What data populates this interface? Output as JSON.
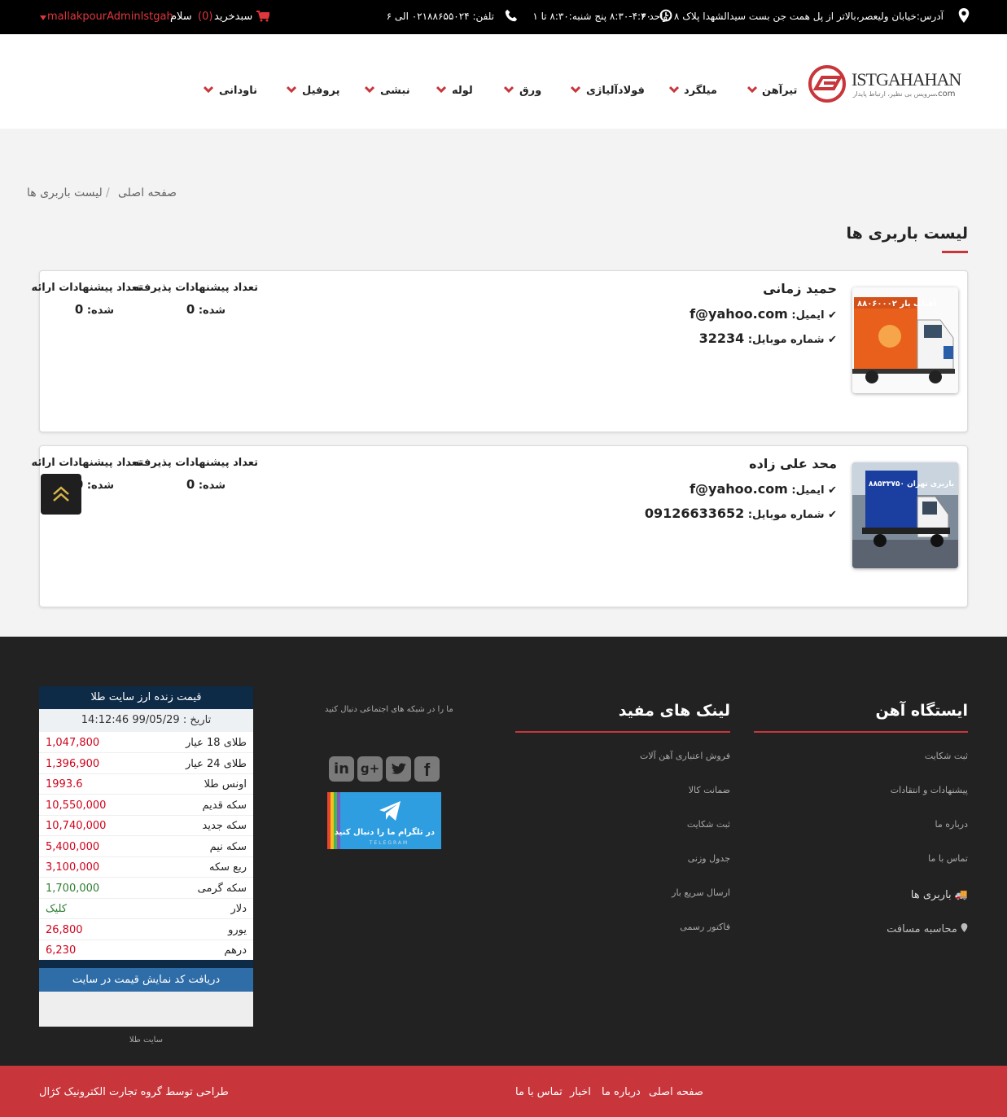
{
  "topbar": {
    "address": "آدرس:خیابان ولیعصر،بالاتر از پل همت جن بست سیدالشهدا پلاک ۸ ،واحد ۶",
    "hours": "۸:۳۰-۴:۳۰ پنج شنبه:۸:۳۰ تا ۱",
    "phone": "تلفن: ۰۲۱۸۸۶۵۵۰۲۴ الی ۶",
    "cart_label": "سبدخرید",
    "cart_count": "(0)",
    "greeting": "سلام",
    "username": "mallakpourAdminIstgah"
  },
  "brand": {
    "name": "ISTGAHAHAN",
    "suffix": ".com",
    "tagline": "سرویس بی نظیر، ارتباط پایدار"
  },
  "nav": [
    "تیرآهن",
    "میلگرد",
    "فولادآلیاژی",
    "ورق",
    "لوله",
    "نبشی",
    "پروفیل",
    "ناودانی"
  ],
  "breadcrumb": {
    "home": "صفحه اصلی",
    "sep": "/",
    "current": "لیست باربری ها"
  },
  "page_title": "لیست باربری ها",
  "carriers": [
    {
      "name": "حمید زمانی",
      "email_label": "ایمیل:",
      "email": "f@yahoo.com",
      "mobile_label": "شماره موبایل:",
      "mobile": "32234",
      "accepted_label": "تعداد پیشنهادات پذیرفته",
      "accepted_suffix": "شده:",
      "accepted": "0",
      "offered_label": "تعداد پیشنهادات ارائه",
      "offered_suffix": "شده:",
      "offered": "0",
      "truck_text": "آفتاب بار ۸۸۰۶۰۰۰۲"
    },
    {
      "name": "محد علی زاده",
      "email_label": "ایمیل:",
      "email": "f@yahoo.com",
      "mobile_label": "شماره موبایل:",
      "mobile": "09126633652",
      "accepted_label": "تعداد پیشنهادات پذیرفته",
      "accepted_suffix": "شده:",
      "accepted": "0",
      "offered_label": "تعداد پیشنهادات ارائه",
      "offered_suffix": "شده:",
      "offered": "0",
      "truck_text": "باربری تهران ۸۸۵۳۳۷۵۰"
    }
  ],
  "footer": {
    "col1": {
      "heading": "ایستگاه آهن",
      "links": [
        "ثبت شکایت",
        "پیشنهادات و انتقادات",
        "درباره ما",
        "تماس با ما",
        "باربری ها",
        "محاسبه مسافت"
      ]
    },
    "col2": {
      "heading": "لینک های مفید",
      "links": [
        "فروش اعتباری آهن آلات",
        "ضمانت کالا",
        "ثبت شکایت",
        "جدول وزنی",
        "ارسال سریع بار",
        "فاکتور رسمی"
      ]
    },
    "social": {
      "text": "ما را در شبکه های اجتماعی دنبال کنید",
      "telegram_text": "در تلگرام ما را دنبال کنید",
      "telegram_sub": "TELEGRAM"
    },
    "gold": {
      "title": "قیمت زنده ارز سایت طلا",
      "date": "تاریخ : 99/05/29 14:12:46",
      "rows": [
        {
          "label": "طلای 18 عیار",
          "price": "1,047,800",
          "color": "#d0021b"
        },
        {
          "label": "طلای 24 عیار",
          "price": "1,396,900",
          "color": "#d0021b"
        },
        {
          "label": "اونس طلا",
          "price": "1993.6",
          "color": "#d0021b"
        },
        {
          "label": "سکه قدیم",
          "price": "10,550,000",
          "color": "#d0021b"
        },
        {
          "label": "سکه جدید",
          "price": "10,740,000",
          "color": "#d0021b"
        },
        {
          "label": "سکه نیم",
          "price": "5,400,000",
          "color": "#d0021b"
        },
        {
          "label": "ربع سکه",
          "price": "3,100,000",
          "color": "#d0021b"
        },
        {
          "label": "سکه گرمی",
          "price": "1,700,000",
          "color": "#2e7d32"
        },
        {
          "label": "دلار",
          "price": "کلیک",
          "color": "#2e7d32"
        },
        {
          "label": "یورو",
          "price": "26,800",
          "color": "#d0021b"
        },
        {
          "label": "درهم",
          "price": "6,230",
          "color": "#d0021b"
        }
      ],
      "code_button": "دریافت کد نمایش قیمت در سایت",
      "credit": "سایت طلا"
    }
  },
  "bottombar": {
    "links": [
      "صفحه اصلی",
      "درباره ما",
      "اخبار",
      "تماس با ما"
    ],
    "credit": "طراحی توسط گروه تجارت الکترونیک کژال"
  },
  "colors": {
    "accent": "#c8363c",
    "dark": "#222222",
    "black": "#000000",
    "gold_header": "#0d2b47",
    "gold_button": "#2f6da8"
  },
  "icons": [
    "map-marker-icon",
    "clock-icon",
    "phone-icon",
    "cart-icon",
    "caret-down-icon",
    "chevron-down-icon",
    "check-icon",
    "chevron-up-icon",
    "truck-icon",
    "linkedin-icon",
    "google-plus-icon",
    "twitter-icon",
    "facebook-icon",
    "telegram-icon"
  ]
}
